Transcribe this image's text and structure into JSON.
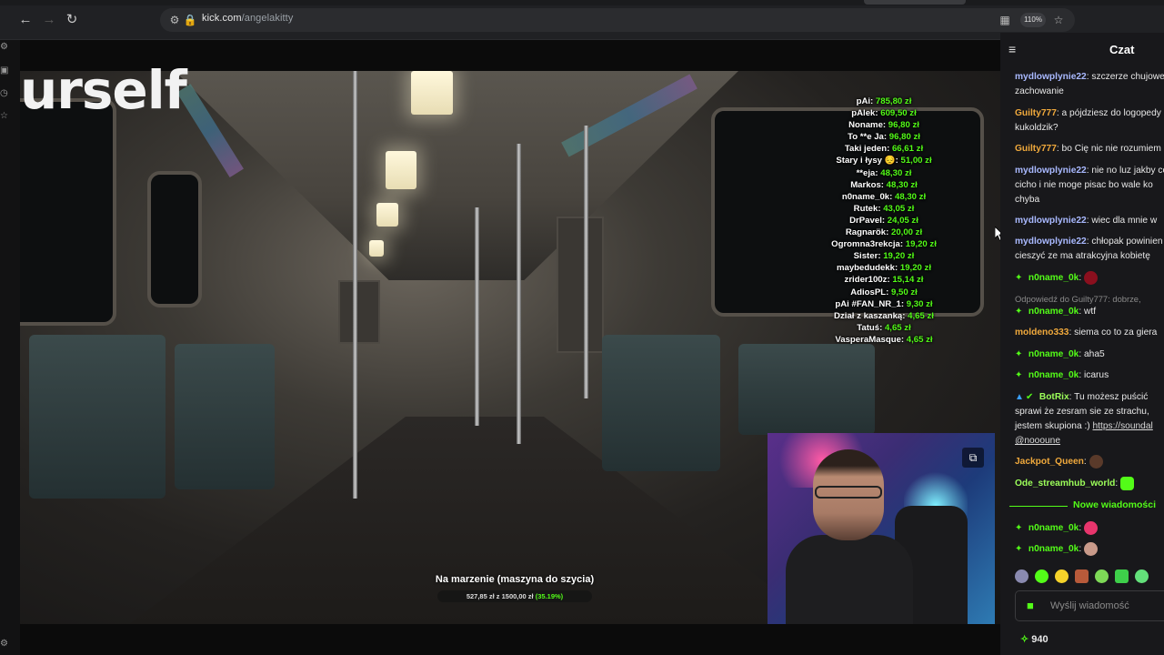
{
  "browser": {
    "url_domain": "kick.com",
    "url_path": "/angelakitty",
    "zoom": "110%",
    "icons": {
      "back": "arrow-left-icon",
      "forward": "arrow-right-icon",
      "reload": "reload-icon",
      "site_info": "tune-icon",
      "lock": "lock-icon",
      "install": "install-app-icon",
      "bookmark": "star-icon"
    }
  },
  "stream": {
    "overlay_title": "urself",
    "donors": [
      {
        "name": "pAi",
        "amount": "785,80 zł"
      },
      {
        "name": "pAlek",
        "amount": "609,50 zł"
      },
      {
        "name": "Noname",
        "amount": "96,80 zł"
      },
      {
        "name": "To **e Ja",
        "amount": "96,80 zł"
      },
      {
        "name": "Taki jeden",
        "amount": "66,61 zł"
      },
      {
        "name": "Stary i łysy 😔",
        "amount": "51,00 zł"
      },
      {
        "name": "**eja",
        "amount": "48,30 zł"
      },
      {
        "name": "Markos",
        "amount": "48,30 zł"
      },
      {
        "name": "n0name_0k",
        "amount": "48,30 zł"
      },
      {
        "name": "Rutek",
        "amount": "43,05 zł"
      },
      {
        "name": "DrPavel",
        "amount": "24,05 zł"
      },
      {
        "name": "Ragnarök",
        "amount": "20,00 zł"
      },
      {
        "name": "Ogromna3rekcja",
        "amount": "19,20 zł"
      },
      {
        "name": "Sister",
        "amount": "19,20 zł"
      },
      {
        "name": "maybedudekk",
        "amount": "19,20 zł"
      },
      {
        "name": "zrider100z",
        "amount": "15,14 zł"
      },
      {
        "name": "AdiosPL",
        "amount": "9,50 zł"
      },
      {
        "name": "pAi #FAN_NR_1",
        "amount": "9,30 zł"
      },
      {
        "name": "Dział z kaszanką",
        "amount": "4,65 zł"
      },
      {
        "name": "Tatuś",
        "amount": "4,65 zł"
      },
      {
        "name": "VasperaMasque",
        "amount": "4,65 zł"
      }
    ],
    "goal": {
      "title": "Na marzenie (maszyna do szycia)",
      "progress_text": "527,85 zł z 1500,00 zł",
      "percent_text": "(35.19%)"
    },
    "pip_icon": "picture-in-picture-icon"
  },
  "chat": {
    "title": "Czat",
    "collapse_icon": "collapse-chat-icon",
    "messages": [
      {
        "user": "mydlowplynie22",
        "text": "szczerze chujowe zachowanie",
        "color": "blue"
      },
      {
        "user": "Guilty777",
        "text": "a pójdziesz do logopedy kukoldzik?",
        "color": "orange"
      },
      {
        "user": "Guilty777",
        "text": "bo Cię nic nie rozumiem",
        "color": "orange"
      },
      {
        "user": "mydlowplynie22",
        "text": "nie no luz jakby co cicho i nie moge pisac bo wale ko chyba",
        "color": "blue"
      },
      {
        "user": "mydlowplynie22",
        "text": "wiec dla mnie w",
        "color": "blue"
      },
      {
        "user": "mydlowplynie22",
        "text": "chłopak powinien cieszyć ze ma atrakcyjna kobietę",
        "color": "blue"
      },
      {
        "user": "n0name_0k",
        "text": "",
        "color": "green",
        "emote": "heart-emote"
      },
      {
        "user": "n0name_0k",
        "text": "wtf",
        "color": "green",
        "reply_to": "Odpowiedź do Guilty777: dobrze,"
      },
      {
        "user": "moldeno333",
        "text": "siema co to za giera",
        "color": "orange"
      },
      {
        "user": "n0name_0k",
        "text": "aha5",
        "color": "green"
      },
      {
        "user": "n0name_0k",
        "text": "icarus",
        "color": "green"
      },
      {
        "user": "BotRix",
        "text": "Tu możesz puścić sprawi że zesram sie ze strachu, jestem skupiona :)",
        "link": "https://soundal",
        "mention": "@noooune",
        "color": "green2"
      },
      {
        "user": "Jackpot_Queen",
        "text": "",
        "color": "orange",
        "emote": "monkey-emote"
      },
      {
        "user": "Ode_streamhub_world",
        "text": "",
        "color": "green2",
        "emote": "frog-emote"
      },
      {
        "user": "n0name_0k",
        "text": "",
        "color": "green",
        "emote": "heart-emote"
      },
      {
        "user": "n0name_0k",
        "text": "",
        "color": "green",
        "emote": "face-emote"
      }
    ],
    "new_messages_label": "Nowe wiadomości",
    "emote_bar": [
      "spiral-emote",
      "frog-emote",
      "yellow-emote",
      "box-emote",
      "alien-emote",
      "smile-emote",
      "ghost-emote"
    ],
    "input_placeholder": "Wyślij wiadomość",
    "points": "940"
  }
}
